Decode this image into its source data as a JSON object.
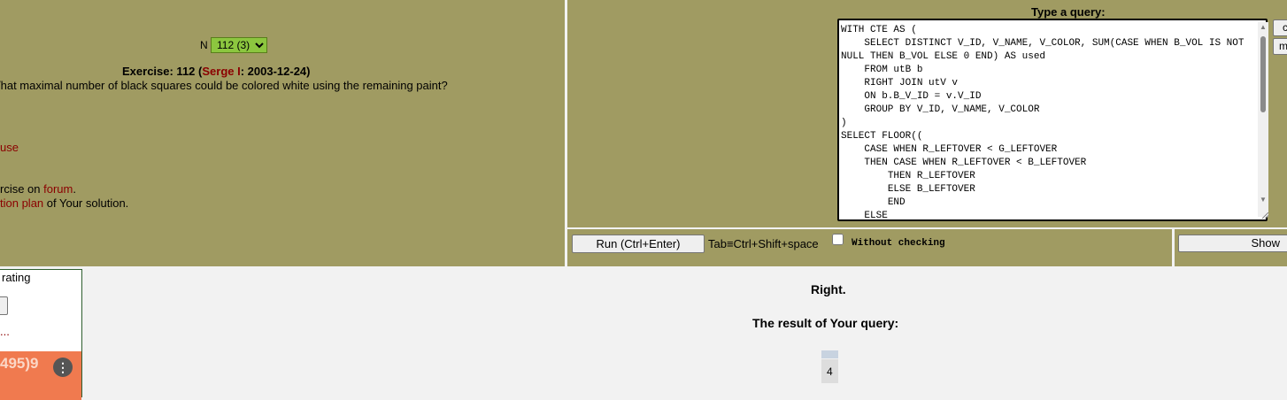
{
  "exercise_selector": {
    "label": "N",
    "selected": "112 (3)"
  },
  "exercise": {
    "prefix": "Exercise: 112 (",
    "author": "Serge I",
    "suffix": ": 2003-12-24)",
    "question": "/hat maximal number of black squares could be colored white using the remaining paint?"
  },
  "links": {
    "use": "use",
    "forum_prefix": "rcise on ",
    "forum": "forum",
    "forum_suffix": ".",
    "plan": "tion plan",
    "plan_suffix": " of Your solution."
  },
  "query": {
    "label": "Type a query:",
    "text": "WITH CTE AS (\n    SELECT DISTINCT V_ID, V_NAME, V_COLOR, SUM(CASE WHEN B_VOL IS NOT NULL THEN B_VOL ELSE 0 END) AS used\n    FROM utB b\n    RIGHT JOIN utV v\n    ON b.B_V_ID = v.V_ID\n    GROUP BY V_ID, V_NAME, V_COLOR\n)\nSELECT FLOOR((\n    CASE WHEN R_LEFTOVER < G_LEFTOVER\n    THEN CASE WHEN R_LEFTOVER < B_LEFTOVER\n        THEN R_LEFTOVER\n        ELSE B_LEFTOVER\n        END\n    ELSE"
  },
  "side_buttons": {
    "top": "c",
    "bottom": "m"
  },
  "toolbar": {
    "run_label": "Run (Ctrl+Enter)",
    "tab_hint": "Tab≡Ctrl+Shift+space",
    "without_checking": "Without checking",
    "show_label": "Show"
  },
  "rating": {
    "title": "rating",
    "ellipsis": "...",
    "badge_text": "495)9"
  },
  "result": {
    "status": "Right.",
    "heading": "The result of Your query:",
    "value": "4"
  }
}
